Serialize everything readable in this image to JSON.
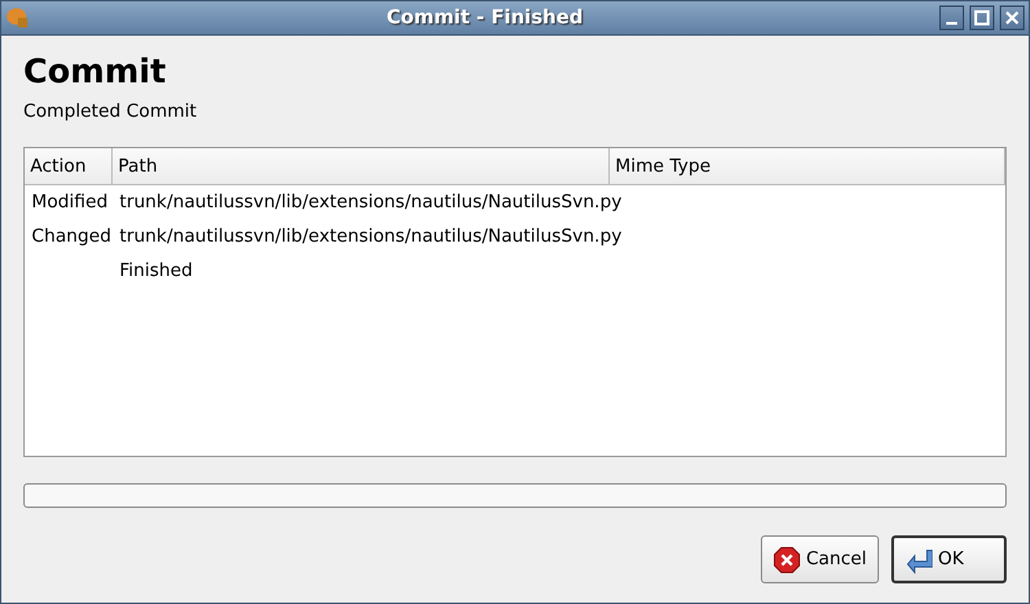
{
  "window": {
    "title": "Commit - Finished"
  },
  "heading": "Commit",
  "subtitle": "Completed Commit",
  "table": {
    "columns": [
      "Action",
      "Path",
      "Mime Type"
    ],
    "rows": [
      {
        "action": "Modified",
        "path": "trunk/nautilussvn/lib/extensions/nautilus/NautilusSvn.py"
      },
      {
        "action": "Changed",
        "path": "trunk/nautilussvn/lib/extensions/nautilus/NautilusSvn.py"
      },
      {
        "action": "",
        "path": "Finished"
      }
    ]
  },
  "progress": {
    "level": 0
  },
  "buttons": [
    {
      "kind": "cancel",
      "label": "Cancel"
    },
    {
      "kind": "ok",
      "label": "OK"
    }
  ]
}
